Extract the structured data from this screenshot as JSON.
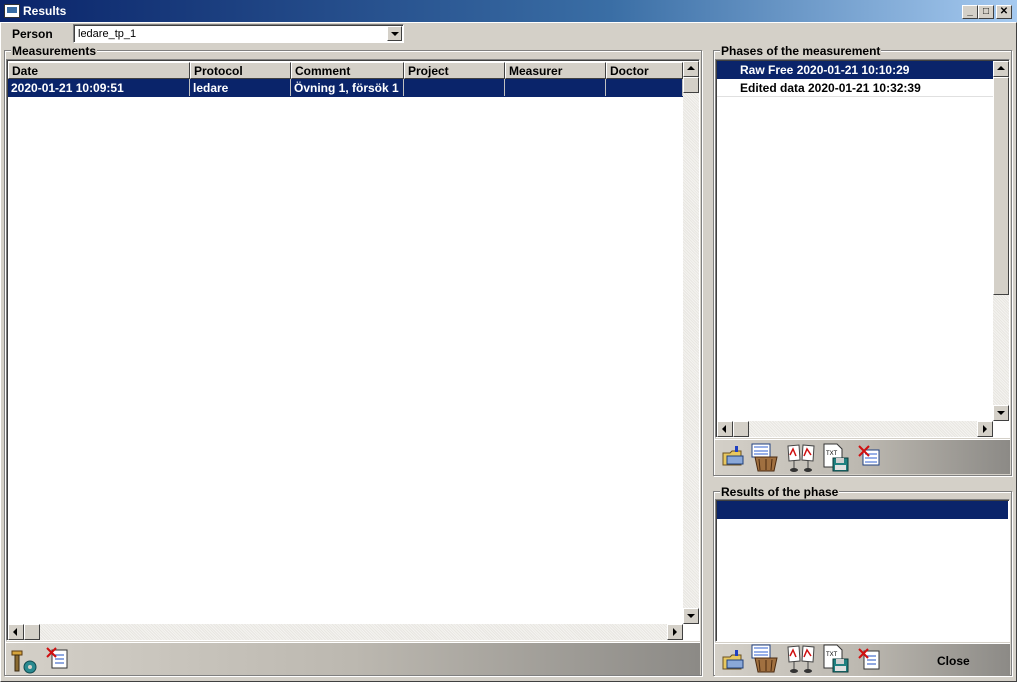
{
  "window": {
    "title": "Results",
    "min_icon": "minimize-icon",
    "max_icon": "maximize-icon",
    "close_icon": "close-icon"
  },
  "person": {
    "label": "Person",
    "value": "ledare_tp_1"
  },
  "measurements": {
    "title": "Measurements",
    "columns": [
      "Date",
      "Protocol",
      "Comment",
      "Project",
      "Measurer",
      "Doctor"
    ],
    "rows": [
      {
        "date": "2020-01-21 10:09:51",
        "protocol": "ledare",
        "comment": "Övning 1, försök 1",
        "project": "",
        "measurer": "",
        "doctor": ""
      }
    ]
  },
  "phases": {
    "title": "Phases of the measurement",
    "items": [
      "Raw Free 2020-01-21 10:10:29",
      "Edited data 2020-01-21 10:32:39"
    ]
  },
  "results": {
    "title": "Results of the phase"
  },
  "buttons": {
    "close": "Close"
  },
  "icons": {
    "measurement_tools": [
      "tools-icon",
      "delete-report-icon"
    ],
    "phase_tools": [
      "open-folder-icon",
      "chart-basket-icon",
      "compare-charts-icon",
      "export-txt-icon",
      "delete-chart-icon"
    ],
    "result_tools": [
      "open-folder-icon",
      "chart-basket-icon",
      "compare-charts-icon",
      "export-txt-icon",
      "delete-report-icon"
    ]
  },
  "colors": {
    "selection": "#0a246a",
    "titlebar": "#0a246a",
    "face": "#d4d0c8"
  }
}
